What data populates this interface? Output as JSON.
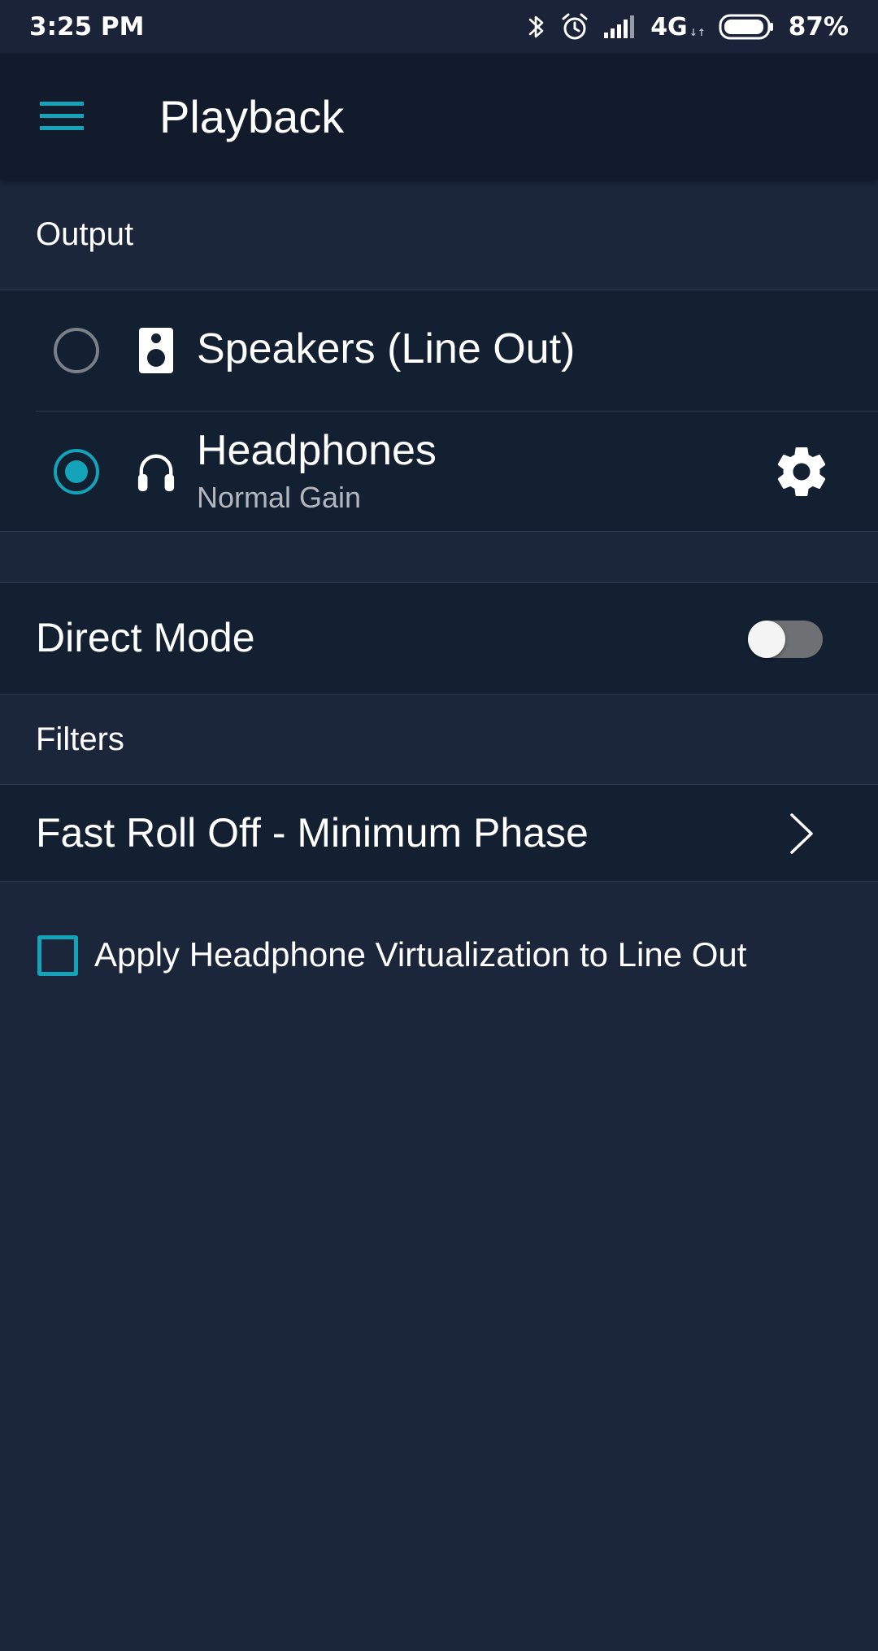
{
  "status_bar": {
    "time": "3:25 PM",
    "network": "4G",
    "network_sub": "↓↑",
    "battery": "87%",
    "icons": [
      "bluetooth-icon",
      "alarm-icon",
      "signal-icon",
      "battery-icon"
    ]
  },
  "app_bar": {
    "title": "Playback",
    "menu_icon": "hamburger-menu-icon"
  },
  "output": {
    "header": "Output",
    "options": [
      {
        "label": "Speakers (Line Out)",
        "sublabel": "",
        "icon": "speaker-icon",
        "selected": false
      },
      {
        "label": "Headphones",
        "sublabel": "Normal Gain",
        "icon": "headphones-icon",
        "selected": true,
        "settings_icon": "gear-icon"
      }
    ]
  },
  "direct_mode": {
    "label": "Direct Mode",
    "enabled": false
  },
  "filters": {
    "header": "Filters",
    "selected": "Fast Roll Off - Minimum Phase",
    "icon": "chevron-right-icon"
  },
  "virtualization": {
    "label": "Apply Headphone Virtualization to Line Out",
    "checked": false
  },
  "colors": {
    "background": "#1b263b",
    "panel": "#132032",
    "app_bar": "#121b2b",
    "accent": "#14a3b8",
    "secondary_text": "#b3b7bd"
  }
}
